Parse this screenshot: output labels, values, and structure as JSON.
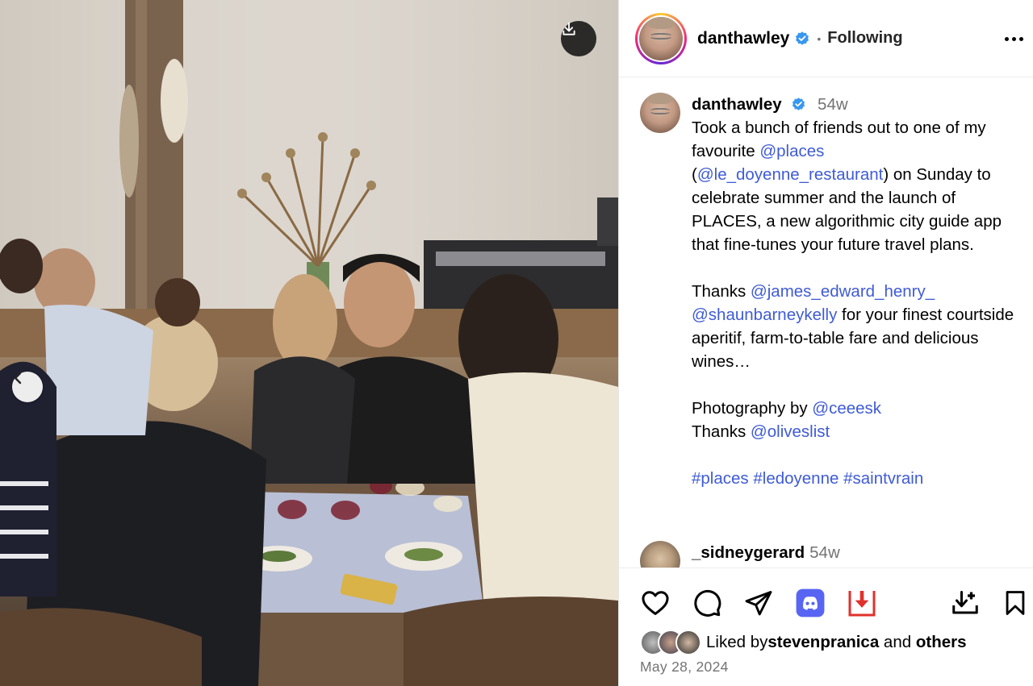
{
  "post": {
    "author": "danthawley",
    "follow_state": "Following",
    "separator": "•"
  },
  "caption": {
    "username": "danthawley",
    "age": "54w",
    "line1a": "Took a bunch of friends out to one of my favourite ",
    "mention_places": "@places",
    "paren_open": "(",
    "mention_restaurant": "@le_doyenne_restaurant",
    "line1b": ") on Sunday to celebrate summer and the launch of PLACES, a new algorithmic city guide app that fine-tunes your future travel plans.",
    "thanks_label": "Thanks ",
    "mention_james": "@james_edward_henry_",
    "mention_shaun": "@shaunbarneykelly",
    "thanks_rest": " for your finest courtside aperitif, farm-to-table fare and delicious wines…",
    "photo_label": "Photography by ",
    "mention_ceeesk": "@ceeesk",
    "thanks2_label": "Thanks ",
    "mention_olives": "@oliveslist",
    "hashtags": [
      "#places",
      "#ledoyenne",
      "#saintvrain"
    ]
  },
  "comment": {
    "username": "_sidneygerard",
    "age": "54w"
  },
  "likes": {
    "prefix": "Liked by ",
    "user": "stevenpranica",
    "middle": " and ",
    "others": "others"
  },
  "date": "May 28, 2024",
  "icons": {
    "like": "heart-icon",
    "comment": "comment-icon",
    "share": "send-icon",
    "discord": "discord-icon",
    "download_ext": "red-download-icon",
    "download_alt": "download-tray-icon",
    "save": "bookmark-icon",
    "photo_download": "download-icon",
    "prev": "chevron-left-icon",
    "more": "more-icon",
    "verified": "verified-badge-icon"
  },
  "colors": {
    "link": "#3f5bd6",
    "verified": "#3897f0",
    "discord": "#5865f2",
    "download_red": "#e0312b",
    "muted": "#737373"
  }
}
